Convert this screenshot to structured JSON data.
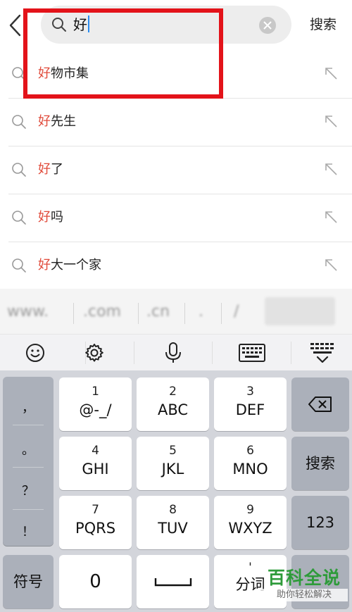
{
  "search": {
    "query": "好",
    "submit_label": "搜索"
  },
  "suggestions": [
    {
      "highlight": "好",
      "rest": "物市集"
    },
    {
      "highlight": "好",
      "rest": "先生"
    },
    {
      "highlight": "好",
      "rest": "了"
    },
    {
      "highlight": "好",
      "rest": "吗"
    },
    {
      "highlight": "好",
      "rest": "大一个家"
    }
  ],
  "quick_inputs": [
    "www.",
    ".com",
    ".cn",
    ".",
    "/"
  ],
  "toolbar": {
    "icons": [
      "emoji-icon",
      "settings-icon",
      "microphone-icon",
      "keyboard-icon",
      "collapse-keyboard-icon"
    ]
  },
  "keyboard": {
    "symbols": [
      "，",
      "。",
      "？",
      "！"
    ],
    "rows": [
      [
        {
          "num": "1",
          "letters": "@-_/"
        },
        {
          "num": "2",
          "letters": "ABC"
        },
        {
          "num": "3",
          "letters": "DEF"
        }
      ],
      [
        {
          "num": "4",
          "letters": "GHI"
        },
        {
          "num": "5",
          "letters": "JKL"
        },
        {
          "num": "6",
          "letters": "MNO"
        }
      ],
      [
        {
          "num": "7",
          "letters": "PQRS"
        },
        {
          "num": "8",
          "letters": "TUV"
        },
        {
          "num": "9",
          "letters": "WXYZ"
        }
      ]
    ],
    "search_label": "搜索",
    "num_mode_label": "123",
    "symbol_label": "符号",
    "zero_label": "0",
    "fenci_num": "'",
    "fenci_label": "分词"
  },
  "watermark": {
    "title": "百科全说",
    "subtitle": "助你轻松解决"
  },
  "colors": {
    "highlight": "#e04a3a",
    "annotation_box": "#e3131a",
    "cursor": "#2a8cf0",
    "watermark": "#2e9b3a"
  }
}
